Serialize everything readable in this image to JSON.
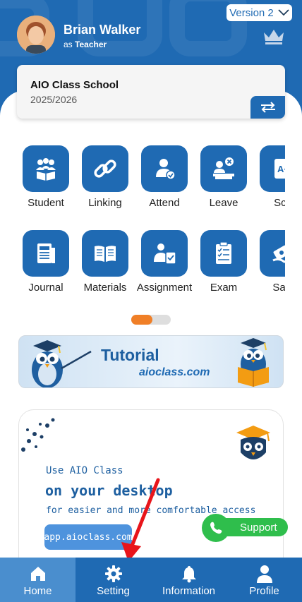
{
  "header": {
    "version_label": "Version 2",
    "user_name": "Brian Walker",
    "role_prefix": "as",
    "role": "Teacher",
    "crown_icon": "crown-icon"
  },
  "school": {
    "name": "AIO Class School",
    "year": "2025/2026",
    "switch_icon": "swap-icon"
  },
  "menu": {
    "row1": [
      {
        "label": "Student",
        "icon": "students-icon"
      },
      {
        "label": "Linking",
        "icon": "link-icon"
      },
      {
        "label": "Attend",
        "icon": "attend-icon"
      },
      {
        "label": "Leave",
        "icon": "leave-icon"
      },
      {
        "label": "Sco",
        "icon": "score-icon"
      }
    ],
    "row2": [
      {
        "label": "Journal",
        "icon": "journal-icon"
      },
      {
        "label": "Materials",
        "icon": "book-icon"
      },
      {
        "label": "Assignment",
        "icon": "assignment-icon"
      },
      {
        "label": "Exam",
        "icon": "exam-icon"
      },
      {
        "label": "Savi",
        "icon": "savings-icon"
      }
    ]
  },
  "tutorial": {
    "title": "Tutorial",
    "subtitle": "aioclass.com"
  },
  "promo": {
    "line1": "Use AIO Class",
    "line2": "on your desktop",
    "line3": "for easier and more comfortable access",
    "url": "app.aioclass.com"
  },
  "support": {
    "label": "Support"
  },
  "nav": [
    {
      "label": "Home",
      "icon": "home-icon",
      "active": true
    },
    {
      "label": "Setting",
      "icon": "gear-icon",
      "active": false
    },
    {
      "label": "Information",
      "icon": "bell-icon",
      "active": false
    },
    {
      "label": "Profile",
      "icon": "person-icon",
      "active": false
    }
  ],
  "colors": {
    "primary": "#1f6ab3",
    "accent": "#f07f27",
    "support_green": "#2fbe4c",
    "arrow_red": "#e8151b"
  }
}
